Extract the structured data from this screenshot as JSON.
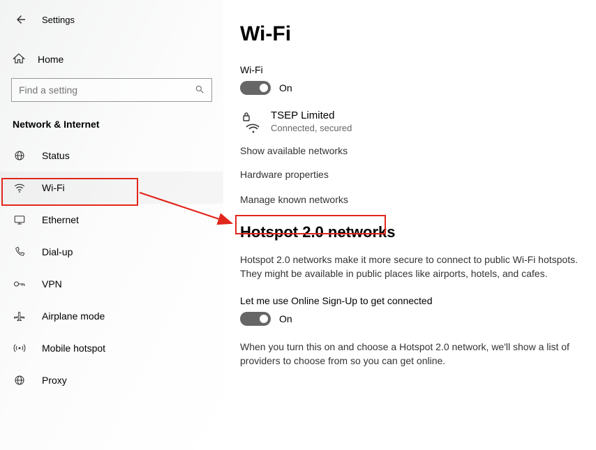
{
  "topbar": {
    "title": "Settings"
  },
  "home_label": "Home",
  "search": {
    "placeholder": "Find a setting"
  },
  "section_header": "Network & Internet",
  "nav": [
    {
      "label": "Status"
    },
    {
      "label": "Wi-Fi"
    },
    {
      "label": "Ethernet"
    },
    {
      "label": "Dial-up"
    },
    {
      "label": "VPN"
    },
    {
      "label": "Airplane mode"
    },
    {
      "label": "Mobile hotspot"
    },
    {
      "label": "Proxy"
    }
  ],
  "main": {
    "title": "Wi-Fi",
    "wifi_label": "Wi-Fi",
    "wifi_toggle": "On",
    "network": {
      "name": "TSEP Limited",
      "status": "Connected, secured"
    },
    "link_show_available": "Show available networks",
    "link_hw_props": "Hardware properties",
    "link_manage_known": "Manage known networks",
    "hotspot_heading": "Hotspot 2.0 networks",
    "hotspot_body": "Hotspot 2.0 networks make it more secure to connect to public Wi-Fi hotspots. They might be available in public places like airports, hotels, and cafes.",
    "hotspot_signup_label": "Let me use Online Sign-Up to get connected",
    "hotspot_toggle": "On",
    "hotspot_footer": "When you turn this on and choose a Hotspot 2.0 network, we'll show a list of providers to choose from so you can get online."
  },
  "annotation_colors": {
    "highlight": "#e1261c"
  }
}
